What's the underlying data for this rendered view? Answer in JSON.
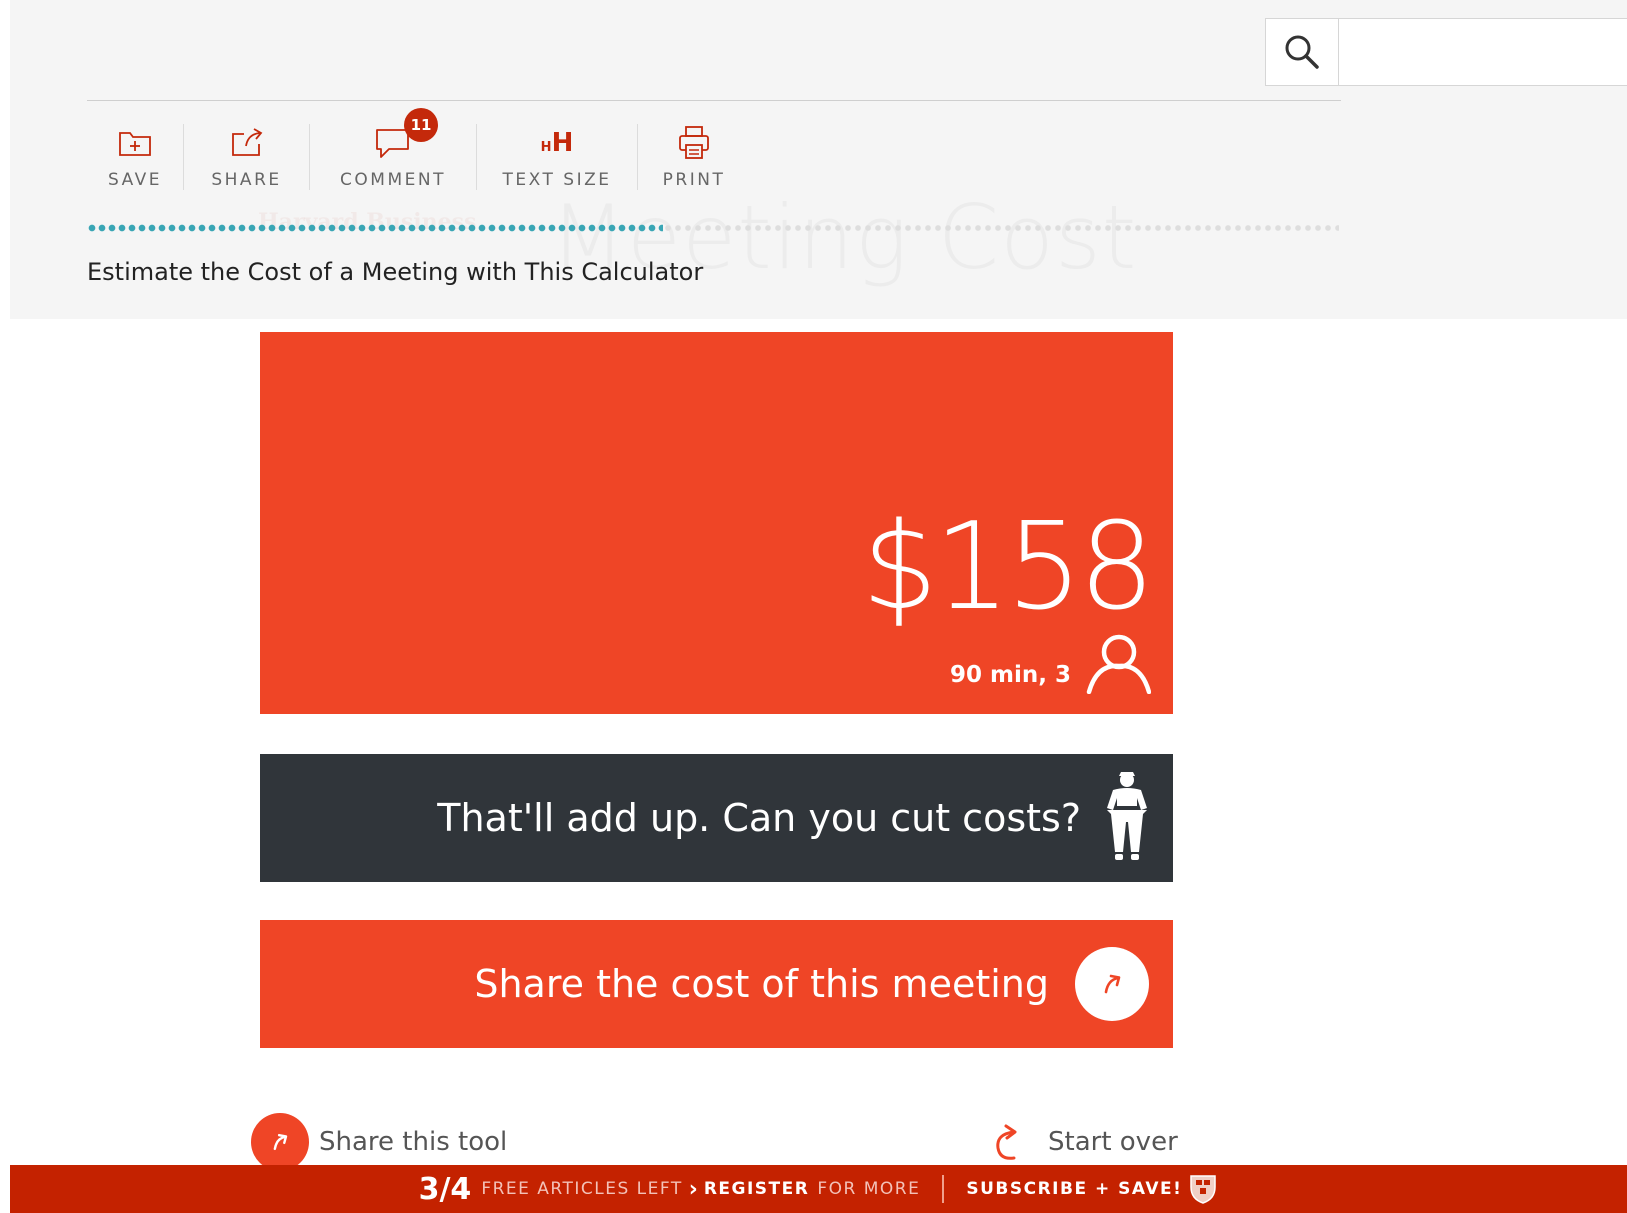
{
  "search": {
    "placeholder": ""
  },
  "toolbar": {
    "items": [
      {
        "label": "SAVE"
      },
      {
        "label": "SHARE"
      },
      {
        "label": "COMMENT",
        "badge": "11"
      },
      {
        "label": "TEXT SIZE",
        "glyph": "HH"
      },
      {
        "label": "PRINT"
      }
    ]
  },
  "progress": {
    "fraction": 0.46
  },
  "article": {
    "title": "Estimate the Cost of a Meeting with This Calculator",
    "ghost_title": "Meeting Cost",
    "ghost_brand": "Harvard Business"
  },
  "result": {
    "amount": "$158",
    "meta": "90 min, 3",
    "meta_icon": "person-icon",
    "advice": "That'll add up. Can you cut costs?",
    "advice_icon": "person-pants-icon",
    "share_label": "Share the cost of this meeting"
  },
  "footer_links": {
    "share_tool": "Share this tool",
    "start_over": "Start over"
  },
  "banner": {
    "count": "3/4",
    "free_left": "FREE ARTICLES LEFT",
    "register": "REGISTER",
    "for_more": "FOR MORE",
    "subscribe": "SUBSCRIBE + SAVE!"
  },
  "colors": {
    "accent": "#ef4526",
    "dark": "#30353a",
    "banner": "#c42200",
    "teal": "#3aa6b5"
  }
}
